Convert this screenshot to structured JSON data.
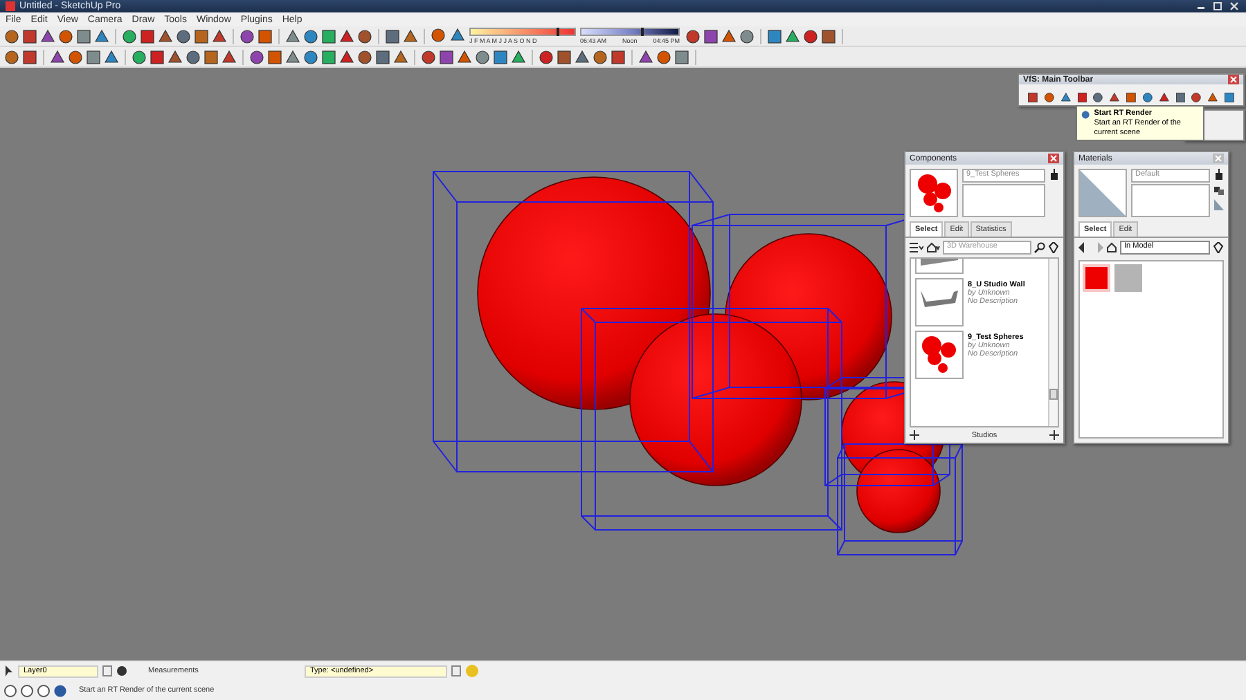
{
  "window": {
    "title": "Untitled - SketchUp Pro"
  },
  "menu": [
    "File",
    "Edit",
    "View",
    "Camera",
    "Draw",
    "Tools",
    "Window",
    "Plugins",
    "Help"
  ],
  "shadow_settings": {
    "months": "J F M A M J J A S O N D",
    "time_start": "06:43 AM",
    "time_mid": "Noon",
    "time_end": "04:45 PM",
    "date_slider": {
      "level": 0.82
    },
    "time_slider": {
      "level": 0.62
    }
  },
  "vfs_toolbar": {
    "title": "VfS: Main Toolbar"
  },
  "tooltip": {
    "title": "Start RT Render",
    "text": "Start an RT Render of the current scene"
  },
  "components": {
    "title": "Components",
    "name": "9_Test Spheres",
    "tabs": [
      {
        "label": "Select",
        "selected": true
      },
      {
        "label": "Edit",
        "selected": false
      },
      {
        "label": "Statistics",
        "selected": false
      }
    ],
    "search": {
      "placeholder": "3D Warehouse"
    },
    "items": [
      {
        "kind": "partial"
      },
      {
        "kind": "wall",
        "name": "8_U Studio Wall",
        "author": "by Unknown",
        "description": "No Description"
      },
      {
        "kind": "spheres",
        "name": "9_Test Spheres",
        "author": "by Unknown",
        "description": "No Description"
      }
    ],
    "footer": "Studios"
  },
  "materials": {
    "title": "Materials",
    "name": "Default",
    "tabs": [
      {
        "label": "Select",
        "selected": true
      },
      {
        "label": "Edit",
        "selected": false
      }
    ],
    "collection": "In Model",
    "swatches": [
      {
        "color": "#ee0000",
        "selected": true
      },
      {
        "color": "#b4b4b4",
        "selected": false
      }
    ]
  },
  "status": {
    "layer": "Layer0",
    "measurements": "Measurements",
    "type": "Type: <undefined>",
    "message": "Start an RT Render of the current scene"
  }
}
